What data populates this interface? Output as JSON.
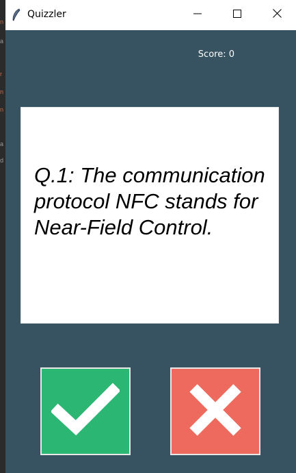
{
  "window": {
    "title": "Quizzler",
    "controls": {
      "minimize_icon": "minimize-icon",
      "maximize_icon": "maximize-icon",
      "close_icon": "close-icon"
    }
  },
  "colors": {
    "background": "#375362",
    "true_button": "#2bb673",
    "false_button": "#ef6a5e",
    "card": "#ffffff"
  },
  "score": {
    "text": "Score: 0"
  },
  "question": {
    "text": "Q.1: The communication protocol NFC stands for Near-Field Control."
  },
  "buttons": {
    "true_icon": "checkmark-icon",
    "false_icon": "cross-icon"
  }
}
